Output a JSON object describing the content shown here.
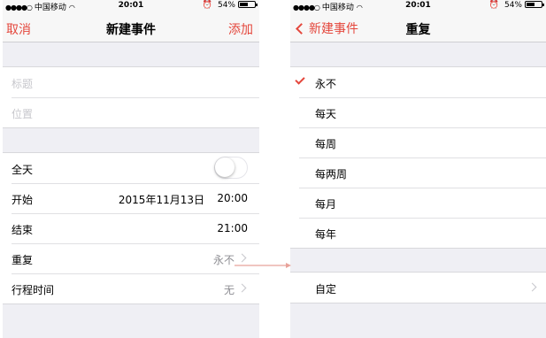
{
  "colors": {
    "accent": "#e4473c",
    "group_bg": "#efeff4",
    "secondary_text": "#8e8e93",
    "separator": "#e0e0e3",
    "arrow": "#e8a29a"
  },
  "status_bar": {
    "carrier": "中国移动",
    "time": "20:01",
    "battery": "54%",
    "battery_level": 0.54
  },
  "left_screen": {
    "nav": {
      "cancel": "取消",
      "title": "新建事件",
      "add": "添加"
    },
    "fields": {
      "title_placeholder": "标题",
      "location_placeholder": "位置"
    },
    "all_day": {
      "label": "全天",
      "on": false
    },
    "start": {
      "label": "开始",
      "date": "2015年11月13日",
      "time": "20:00"
    },
    "end": {
      "label": "结束",
      "time": "21:00"
    },
    "repeat": {
      "label": "重复",
      "value": "永不"
    },
    "travel_time": {
      "label": "行程时间",
      "value": "无"
    }
  },
  "right_screen": {
    "nav": {
      "back": "新建事件",
      "title": "重复"
    },
    "options": [
      "永不",
      "每天",
      "每周",
      "每两周",
      "每月",
      "每年"
    ],
    "selected_index": 0,
    "custom": "自定"
  }
}
